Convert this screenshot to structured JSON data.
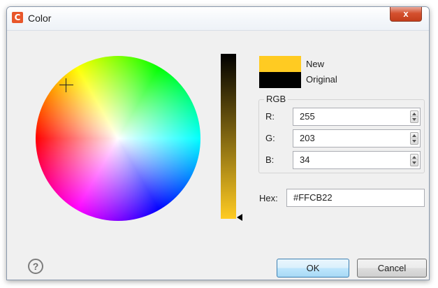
{
  "window": {
    "title": "Color",
    "app_icon_letter": "C",
    "close_symbol": "x"
  },
  "picker": {
    "crosshair_icon": "crosshair-icon",
    "brightness_marker_icon": "triangle-left-icon"
  },
  "swatches": {
    "new_label": "New",
    "original_label": "Original",
    "new_color": "#FFCB22",
    "original_color": "#000000"
  },
  "rgb": {
    "group_label": "RGB",
    "fields": [
      {
        "label": "R:",
        "value": "255"
      },
      {
        "label": "G:",
        "value": "203"
      },
      {
        "label": "B:",
        "value": "34"
      }
    ]
  },
  "hex": {
    "label": "Hex:",
    "value": "#FFCB22"
  },
  "footer": {
    "help_symbol": "?",
    "ok_label": "OK",
    "cancel_label": "Cancel"
  }
}
